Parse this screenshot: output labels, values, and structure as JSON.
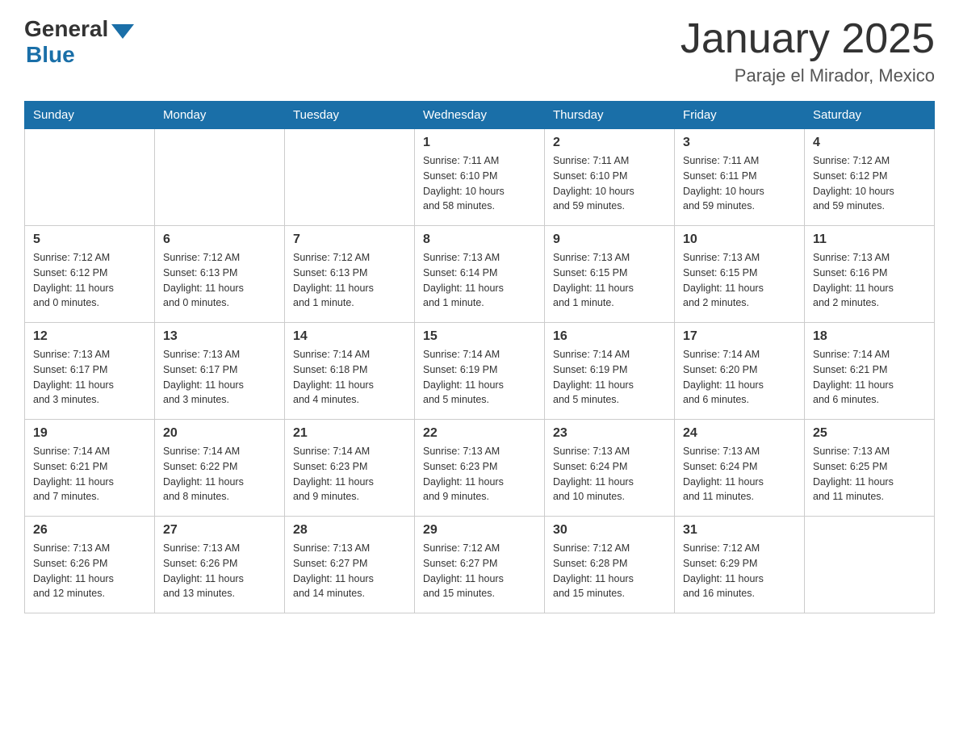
{
  "header": {
    "logo_general": "General",
    "logo_blue": "Blue",
    "month_title": "January 2025",
    "location": "Paraje el Mirador, Mexico"
  },
  "days_of_week": [
    "Sunday",
    "Monday",
    "Tuesday",
    "Wednesday",
    "Thursday",
    "Friday",
    "Saturday"
  ],
  "weeks": [
    [
      {
        "day": "",
        "info": ""
      },
      {
        "day": "",
        "info": ""
      },
      {
        "day": "",
        "info": ""
      },
      {
        "day": "1",
        "info": "Sunrise: 7:11 AM\nSunset: 6:10 PM\nDaylight: 10 hours\nand 58 minutes."
      },
      {
        "day": "2",
        "info": "Sunrise: 7:11 AM\nSunset: 6:10 PM\nDaylight: 10 hours\nand 59 minutes."
      },
      {
        "day": "3",
        "info": "Sunrise: 7:11 AM\nSunset: 6:11 PM\nDaylight: 10 hours\nand 59 minutes."
      },
      {
        "day": "4",
        "info": "Sunrise: 7:12 AM\nSunset: 6:12 PM\nDaylight: 10 hours\nand 59 minutes."
      }
    ],
    [
      {
        "day": "5",
        "info": "Sunrise: 7:12 AM\nSunset: 6:12 PM\nDaylight: 11 hours\nand 0 minutes."
      },
      {
        "day": "6",
        "info": "Sunrise: 7:12 AM\nSunset: 6:13 PM\nDaylight: 11 hours\nand 0 minutes."
      },
      {
        "day": "7",
        "info": "Sunrise: 7:12 AM\nSunset: 6:13 PM\nDaylight: 11 hours\nand 1 minute."
      },
      {
        "day": "8",
        "info": "Sunrise: 7:13 AM\nSunset: 6:14 PM\nDaylight: 11 hours\nand 1 minute."
      },
      {
        "day": "9",
        "info": "Sunrise: 7:13 AM\nSunset: 6:15 PM\nDaylight: 11 hours\nand 1 minute."
      },
      {
        "day": "10",
        "info": "Sunrise: 7:13 AM\nSunset: 6:15 PM\nDaylight: 11 hours\nand 2 minutes."
      },
      {
        "day": "11",
        "info": "Sunrise: 7:13 AM\nSunset: 6:16 PM\nDaylight: 11 hours\nand 2 minutes."
      }
    ],
    [
      {
        "day": "12",
        "info": "Sunrise: 7:13 AM\nSunset: 6:17 PM\nDaylight: 11 hours\nand 3 minutes."
      },
      {
        "day": "13",
        "info": "Sunrise: 7:13 AM\nSunset: 6:17 PM\nDaylight: 11 hours\nand 3 minutes."
      },
      {
        "day": "14",
        "info": "Sunrise: 7:14 AM\nSunset: 6:18 PM\nDaylight: 11 hours\nand 4 minutes."
      },
      {
        "day": "15",
        "info": "Sunrise: 7:14 AM\nSunset: 6:19 PM\nDaylight: 11 hours\nand 5 minutes."
      },
      {
        "day": "16",
        "info": "Sunrise: 7:14 AM\nSunset: 6:19 PM\nDaylight: 11 hours\nand 5 minutes."
      },
      {
        "day": "17",
        "info": "Sunrise: 7:14 AM\nSunset: 6:20 PM\nDaylight: 11 hours\nand 6 minutes."
      },
      {
        "day": "18",
        "info": "Sunrise: 7:14 AM\nSunset: 6:21 PM\nDaylight: 11 hours\nand 6 minutes."
      }
    ],
    [
      {
        "day": "19",
        "info": "Sunrise: 7:14 AM\nSunset: 6:21 PM\nDaylight: 11 hours\nand 7 minutes."
      },
      {
        "day": "20",
        "info": "Sunrise: 7:14 AM\nSunset: 6:22 PM\nDaylight: 11 hours\nand 8 minutes."
      },
      {
        "day": "21",
        "info": "Sunrise: 7:14 AM\nSunset: 6:23 PM\nDaylight: 11 hours\nand 9 minutes."
      },
      {
        "day": "22",
        "info": "Sunrise: 7:13 AM\nSunset: 6:23 PM\nDaylight: 11 hours\nand 9 minutes."
      },
      {
        "day": "23",
        "info": "Sunrise: 7:13 AM\nSunset: 6:24 PM\nDaylight: 11 hours\nand 10 minutes."
      },
      {
        "day": "24",
        "info": "Sunrise: 7:13 AM\nSunset: 6:24 PM\nDaylight: 11 hours\nand 11 minutes."
      },
      {
        "day": "25",
        "info": "Sunrise: 7:13 AM\nSunset: 6:25 PM\nDaylight: 11 hours\nand 11 minutes."
      }
    ],
    [
      {
        "day": "26",
        "info": "Sunrise: 7:13 AM\nSunset: 6:26 PM\nDaylight: 11 hours\nand 12 minutes."
      },
      {
        "day": "27",
        "info": "Sunrise: 7:13 AM\nSunset: 6:26 PM\nDaylight: 11 hours\nand 13 minutes."
      },
      {
        "day": "28",
        "info": "Sunrise: 7:13 AM\nSunset: 6:27 PM\nDaylight: 11 hours\nand 14 minutes."
      },
      {
        "day": "29",
        "info": "Sunrise: 7:12 AM\nSunset: 6:27 PM\nDaylight: 11 hours\nand 15 minutes."
      },
      {
        "day": "30",
        "info": "Sunrise: 7:12 AM\nSunset: 6:28 PM\nDaylight: 11 hours\nand 15 minutes."
      },
      {
        "day": "31",
        "info": "Sunrise: 7:12 AM\nSunset: 6:29 PM\nDaylight: 11 hours\nand 16 minutes."
      },
      {
        "day": "",
        "info": ""
      }
    ]
  ]
}
